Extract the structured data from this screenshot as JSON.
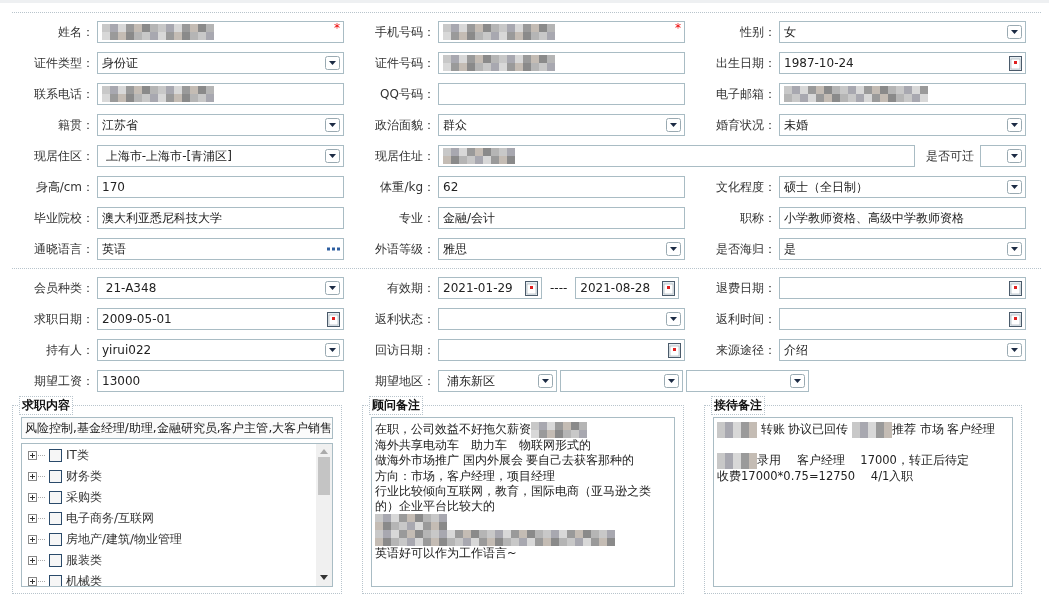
{
  "personal": {
    "fields": [
      {
        "label": "姓名：",
        "kind": "text",
        "redacted": true,
        "required_mark": "*"
      },
      {
        "label": "手机号码：",
        "kind": "text",
        "redacted": true,
        "required_mark": "*"
      },
      {
        "label": "性别：",
        "kind": "select",
        "value": "女"
      },
      {
        "label": "证件类型：",
        "kind": "select",
        "value": "身份证"
      },
      {
        "label": "证件号码：",
        "kind": "text",
        "redacted": true
      },
      {
        "label": "出生日期：",
        "kind": "date",
        "value": "1987-10-24"
      },
      {
        "label": "联系电话：",
        "kind": "text",
        "redacted": true
      },
      {
        "label": "QQ号码：",
        "kind": "text"
      },
      {
        "label": "电子邮箱：",
        "kind": "text",
        "redacted": true
      },
      {
        "label": "籍贯：",
        "kind": "select",
        "value": "江苏省"
      },
      {
        "label": "政治面貌：",
        "kind": "select",
        "value": "群众"
      },
      {
        "label": "婚育状况：",
        "kind": "select",
        "value": "未婚"
      },
      {
        "label": "现居住区：",
        "kind": "select",
        "value": " 上海市-上海市-[青浦区]"
      },
      {
        "label": "现居住址：",
        "kind": "address",
        "redacted": true,
        "extra_label": "是否可迁"
      },
      {
        "label": "身高/cm：",
        "kind": "text",
        "value": "170"
      },
      {
        "label": "体重/kg：",
        "kind": "text",
        "value": "62"
      },
      {
        "label": "文化程度：",
        "kind": "select",
        "value": "硕士（全日制）"
      },
      {
        "label": "毕业院校：",
        "kind": "text",
        "value": "澳大利亚悉尼科技大学"
      },
      {
        "label": "专业：",
        "kind": "text",
        "value": "金融/会计"
      },
      {
        "label": "职称：",
        "kind": "text",
        "value": "小学教师资格、高级中学教师资格"
      },
      {
        "label": "通晓语言：",
        "kind": "lookup",
        "value": "英语"
      },
      {
        "label": "外语等级：",
        "kind": "select",
        "value": "雅思"
      },
      {
        "label": "是否海归：",
        "kind": "select",
        "value": "是"
      }
    ]
  },
  "membership": {
    "fields": [
      {
        "label": "会员种类：",
        "kind": "select",
        "value": " 21-A348"
      },
      {
        "label": "有效期：",
        "kind": "range",
        "from": "2021-01-29",
        "separator": "----",
        "to": "2021-08-28"
      },
      {
        "label": "退费日期：",
        "kind": "date"
      },
      {
        "label": "求职日期：",
        "kind": "date",
        "value": "2009-05-01"
      },
      {
        "label": "返利状态：",
        "kind": "select"
      },
      {
        "label": "返利时间：",
        "kind": "date"
      },
      {
        "label": "持有人：",
        "kind": "select",
        "value": "yirui022"
      },
      {
        "label": "回访日期：",
        "kind": "date"
      },
      {
        "label": "来源途径：",
        "kind": "select",
        "value": "介绍"
      },
      {
        "label": "期望工资：",
        "kind": "text",
        "value": "13000"
      },
      {
        "label": "期望地区：",
        "kind": "region",
        "selects": [
          {
            "kind": "dropdown",
            "value": " 浦东新区"
          },
          {
            "kind": "dropdown"
          },
          {
            "kind": "dropdown"
          }
        ]
      }
    ]
  },
  "job_panel": {
    "title": "求职内容",
    "value": "风险控制,基金经理/助理,金融研究员,客户主管,大客户销售",
    "tree": [
      {
        "label": "IT类",
        "expanded": false,
        "checked": false
      },
      {
        "label": "财务类",
        "expanded": false,
        "checked": false
      },
      {
        "label": "采购类",
        "expanded": false,
        "checked": false
      },
      {
        "label": "电子商务/互联网",
        "expanded": false,
        "checked": false
      },
      {
        "label": "房地产/建筑/物业管理",
        "expanded": false,
        "checked": false
      },
      {
        "label": "服装类",
        "expanded": false,
        "checked": false
      },
      {
        "label": "机械类",
        "expanded": false,
        "checked": false
      }
    ]
  },
  "notes": [
    {
      "title": "顾问备注",
      "lines": [
        {
          "segments": [
            {
              "text": "在职，公司效益不好拖欠薪资"
            },
            {
              "redacted": true
            }
          ]
        },
        {
          "segments": [
            {
              "text": "海外共享电动车　助力车　物联网形式的"
            }
          ]
        },
        {
          "segments": [
            {
              "text": "做海外市场推广 国内外展会 要自己去获客那种的"
            }
          ]
        },
        {
          "segments": [
            {
              "text": "方向：市场，客户经理，项目经理"
            }
          ]
        },
        {
          "segments": [
            {
              "text": "行业比较倾向互联网，教育，国际电商（亚马逊之类"
            }
          ]
        },
        {
          "segments": [
            {
              "text": "的）企业平台比较大的"
            }
          ]
        },
        {
          "segments": [
            {
              "redacted": true
            }
          ]
        },
        {
          "segments": [
            {
              "redacted": true
            }
          ]
        },
        {
          "segments": [
            {
              "text": "英语好可以作为工作语言~"
            }
          ]
        }
      ]
    },
    {
      "title": "接待备注",
      "lines": [
        {
          "segments": [
            {
              "redacted": true
            },
            {
              "text": " 转账 协议已回传 "
            },
            {
              "redacted": true
            },
            {
              "text": "推荐 市场 客户经理"
            }
          ]
        },
        {
          "space_before": true,
          "segments": [
            {
              "redacted": true
            },
            {
              "text": "录用　 客户经理　 17000，转正后待定"
            }
          ]
        },
        {
          "segments": [
            {
              "text": "收费17000*0.75=12750　 4/1入职"
            }
          ]
        }
      ]
    }
  ]
}
